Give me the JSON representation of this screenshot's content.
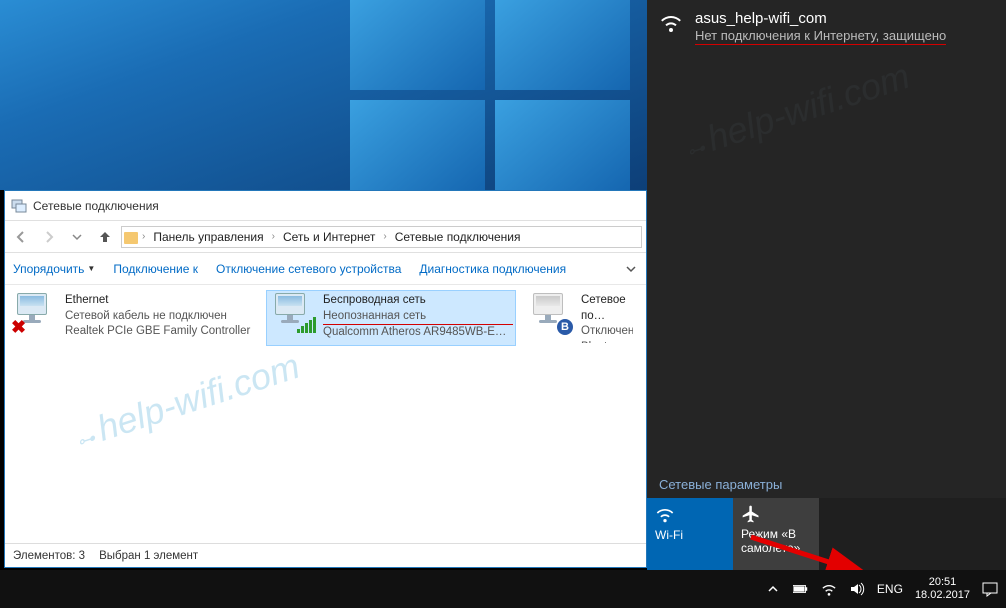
{
  "wallpaper": {},
  "explorer": {
    "title": "Сетевые подключения",
    "breadcrumb": [
      "Панель управления",
      "Сеть и Интернет",
      "Сетевые подключения"
    ],
    "toolbar": {
      "organize": "Упорядочить",
      "connect": "Подключение к",
      "disable": "Отключение сетевого устройства",
      "diagnose": "Диагностика подключения"
    },
    "connections": [
      {
        "name": "Ethernet",
        "status": "Сетевой кабель не подключен",
        "detail": "Realtek PCIe GBE Family Controller",
        "icon": "ethernet",
        "selected": false,
        "underlined": false
      },
      {
        "name": "Беспроводная сеть",
        "status": "Неопознанная сеть",
        "detail": "Qualcomm Atheros AR9485WB-E…",
        "icon": "wifi",
        "selected": true,
        "underlined": true
      },
      {
        "name": "Сетевое по…",
        "status": "Отключено",
        "detail": "Bluetooth D…",
        "icon": "bluetooth",
        "selected": false,
        "underlined": false
      }
    ],
    "status_bar": {
      "count": "Элементов: 3",
      "selected": "Выбран 1 элемент"
    }
  },
  "net_panel": {
    "ssid": "asus_help-wifi_com",
    "state": "Нет подключения к Интернету, защищено",
    "settings_label": "Сетевые параметры",
    "tiles": {
      "wifi": "Wi-Fi",
      "airplane_line1": "Режим «В",
      "airplane_line2": "самолете»"
    }
  },
  "tray": {
    "lang": "ENG",
    "time": "20:51",
    "date": "18.02.2017"
  },
  "watermark": {
    "text_prefix": "help-",
    "text_main": "wifi.com"
  }
}
